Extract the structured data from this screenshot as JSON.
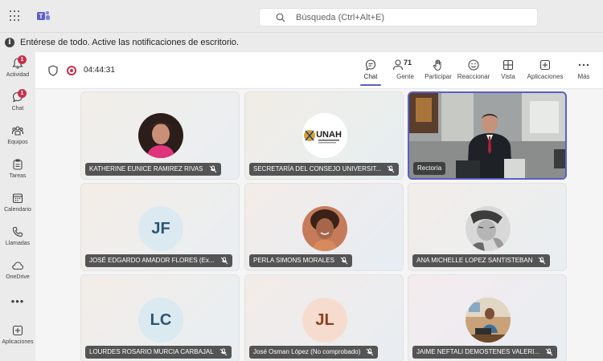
{
  "search": {
    "placeholder": "Búsqueda (Ctrl+Alt+E)"
  },
  "banner": {
    "text": "Entérese de todo. Active las notificaciones de escritorio."
  },
  "rail": {
    "items": [
      {
        "label": "Actividad",
        "icon": "bell-icon",
        "badge": "1"
      },
      {
        "label": "Chat",
        "icon": "chat-icon",
        "badge": "1"
      },
      {
        "label": "Equipos",
        "icon": "teams-icon"
      },
      {
        "label": "Tareas",
        "icon": "tasks-icon"
      },
      {
        "label": "Calendario",
        "icon": "calendar-icon"
      },
      {
        "label": "Llamadas",
        "icon": "phone-icon"
      },
      {
        "label": "OneDrive",
        "icon": "cloud-icon"
      },
      {
        "label": "Aplicaciones",
        "icon": "add-apps-icon"
      }
    ],
    "more": "•••"
  },
  "meeting": {
    "timer": "04:44:31",
    "people_count": "71",
    "tools": [
      {
        "label": "Chat",
        "icon": "chat-bubble-icon",
        "active": true
      },
      {
        "label": "Gente",
        "icon": "people-icon"
      },
      {
        "label": "Participar",
        "icon": "raise-hand-icon"
      },
      {
        "label": "Reaccionar",
        "icon": "smile-icon"
      },
      {
        "label": "Vista",
        "icon": "grid-view-icon"
      },
      {
        "label": "Aplicaciones",
        "icon": "add-app-icon"
      },
      {
        "label": "Más",
        "icon": "more-icon"
      }
    ]
  },
  "participants": [
    {
      "name": "KATHERINE EUNICE RAMIREZ RIVAS",
      "type": "photo",
      "muted": true
    },
    {
      "name": "SECRETARÍA DEL CONSEJO UNIVERSIT...",
      "type": "logo",
      "logo_text": "UNAH",
      "muted": true
    },
    {
      "name": "Rectoría",
      "type": "video",
      "muted": false,
      "speaking": true
    },
    {
      "name": "JOSÉ EDGARDO AMADOR FLORES (Ex...",
      "type": "initials",
      "initials": "JF",
      "avatar_bg": "#dbe9f1",
      "avatar_fg": "#2b5775",
      "muted": true
    },
    {
      "name": "PERLA SIMONS MORALES",
      "type": "photo",
      "muted": true
    },
    {
      "name": "ANA MICHELLE LOPEZ SANTISTEBAN",
      "type": "photo",
      "muted": true
    },
    {
      "name": "LOURDES ROSARIO MURCIA CARBAJAL",
      "type": "initials",
      "initials": "LC",
      "avatar_bg": "#dbe9f1",
      "avatar_fg": "#2b5775",
      "muted": true
    },
    {
      "name": "José Osman López (No comprobado)",
      "type": "initials",
      "initials": "JL",
      "avatar_bg": "#f6dccf",
      "avatar_fg": "#8a3f1f",
      "muted": true
    },
    {
      "name": "JAIME NEFTALI DEMOSTENES VALERI...",
      "type": "photo",
      "muted": true
    }
  ],
  "colors": {
    "accent": "#5b5fc7",
    "badge": "#c4314b",
    "record": "#c4314b"
  }
}
